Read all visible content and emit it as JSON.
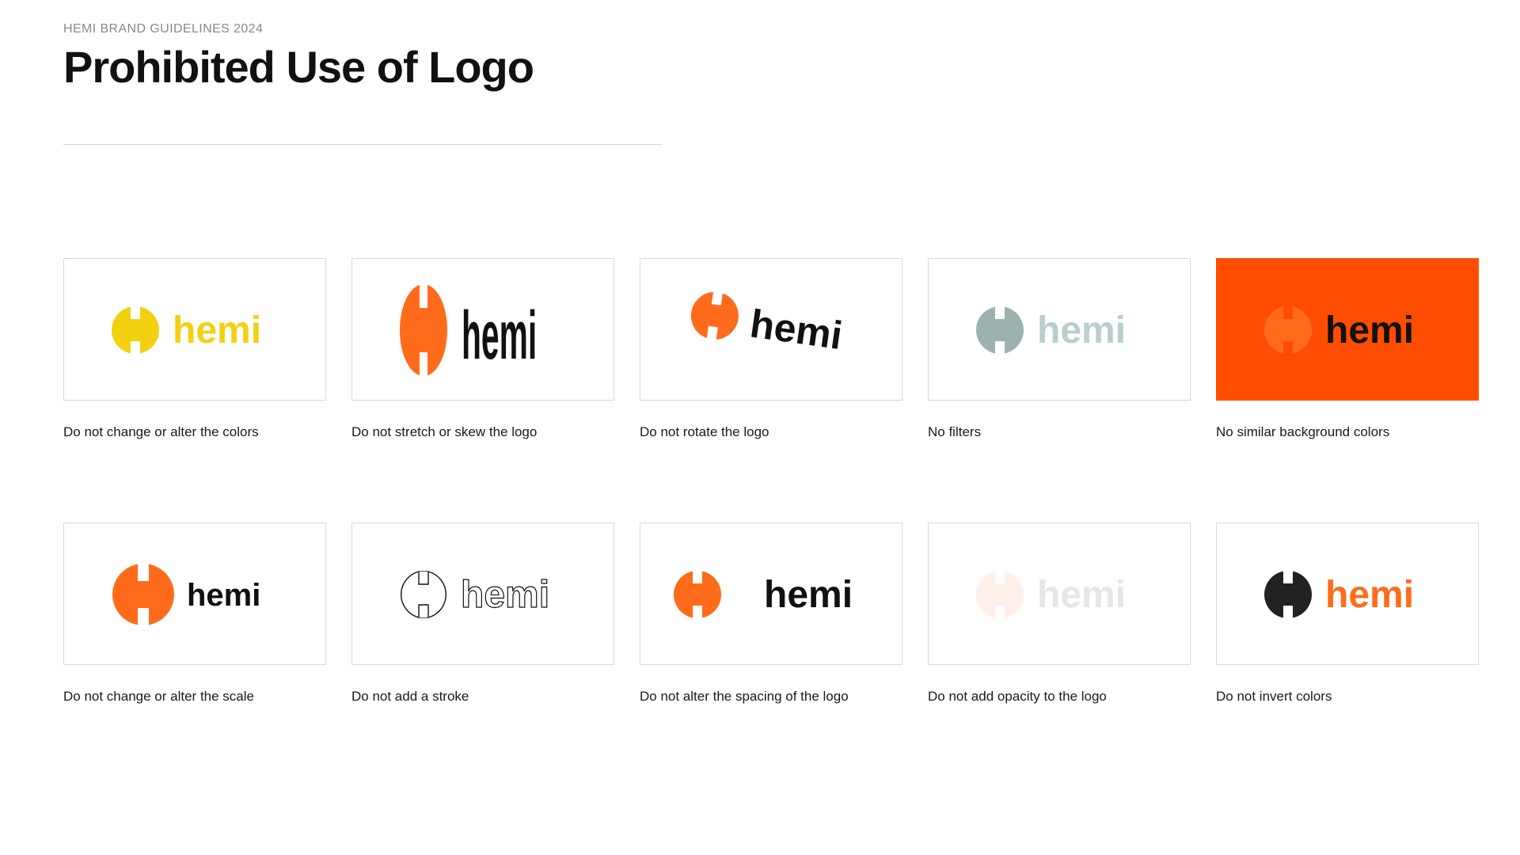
{
  "header": {
    "eyebrow": "HEMI BRAND GUIDELINES 2024",
    "title": "Prohibited Use of Logo"
  },
  "logo": {
    "wordmark": "hemi"
  },
  "colors": {
    "brand_orange": "#FF6B1A",
    "background_orange": "#FF4D00",
    "alt_yellow": "#F2D110",
    "filter_gray": "#9BB2B1",
    "filter_wordmark": "#B8CFCD",
    "black": "#111111",
    "inverted_mark": "#222222",
    "faded_mark": "#FFF0EA",
    "faded_wordmark": "#E6E6E6",
    "tile_border": "#D9D9D9"
  },
  "examples": [
    {
      "id": "colors",
      "caption": "Do not change or alter the colors"
    },
    {
      "id": "stretch",
      "caption": "Do not stretch or skew the logo"
    },
    {
      "id": "rotate",
      "caption": "Do not rotate the logo"
    },
    {
      "id": "filters",
      "caption": "No filters"
    },
    {
      "id": "similar-background",
      "caption": "No similar background colors"
    },
    {
      "id": "scale",
      "caption": "Do not change or alter the scale"
    },
    {
      "id": "stroke",
      "caption": "Do not add a stroke"
    },
    {
      "id": "spacing",
      "caption": "Do not alter the spacing of the logo"
    },
    {
      "id": "opacity",
      "caption": "Do not add opacity to the logo"
    },
    {
      "id": "invert",
      "caption": "Do not invert colors"
    }
  ]
}
